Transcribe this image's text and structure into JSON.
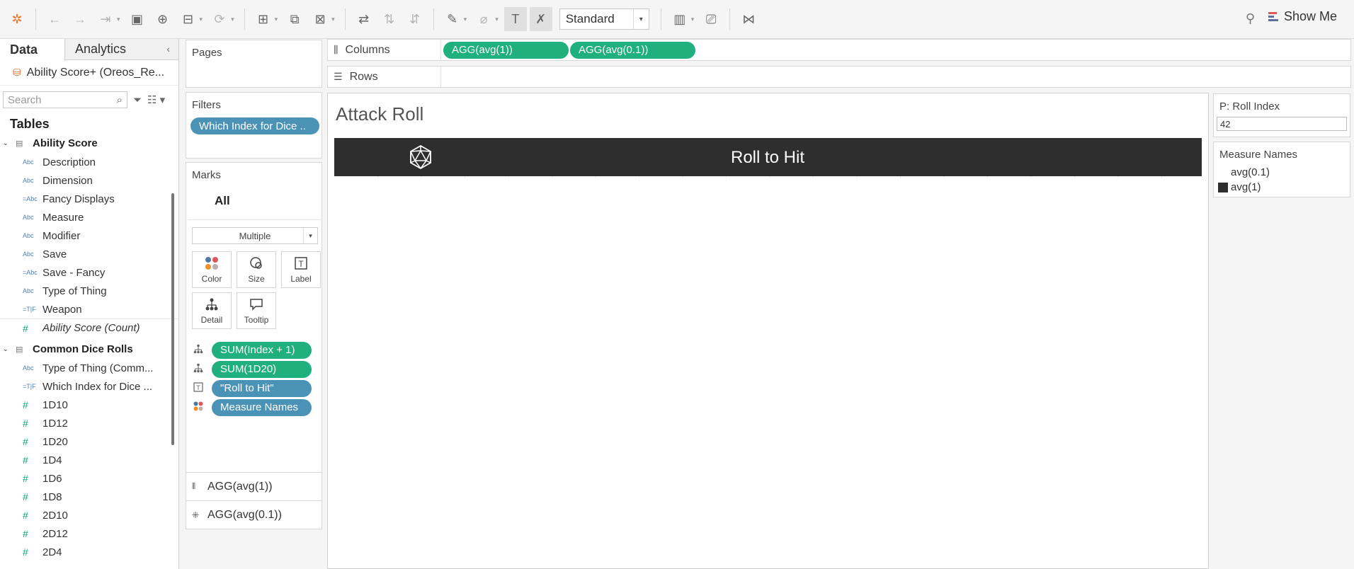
{
  "toolbar": {
    "fit_value": "Standard",
    "show_me_label": "Show Me"
  },
  "data_pane": {
    "tabs": [
      "Data",
      "Analytics"
    ],
    "datasource": "Ability Score+ (Oreos_Re...",
    "search_placeholder": "Search",
    "tables_title": "Tables",
    "tables": [
      {
        "name": "Ability Score",
        "fields": [
          {
            "type": "Abc",
            "name": "Description"
          },
          {
            "type": "Abc",
            "name": "Dimension"
          },
          {
            "type": "=Abc",
            "name": "Fancy Displays"
          },
          {
            "type": "Abc",
            "name": "Measure"
          },
          {
            "type": "Abc",
            "name": "Modifier"
          },
          {
            "type": "Abc",
            "name": "Save"
          },
          {
            "type": "=Abc",
            "name": "Save - Fancy"
          },
          {
            "type": "Abc",
            "name": "Type of Thing"
          },
          {
            "type": "=T|F",
            "name": "Weapon"
          },
          {
            "type": "#",
            "name": "Ability Score (Count)",
            "italic": true
          }
        ]
      },
      {
        "name": "Common Dice Rolls",
        "fields": [
          {
            "type": "Abc",
            "name": "Type of Thing (Comm..."
          },
          {
            "type": "=T|F",
            "name": "Which Index for Dice ..."
          },
          {
            "type": "#",
            "name": "1D10"
          },
          {
            "type": "#",
            "name": "1D12"
          },
          {
            "type": "#",
            "name": "1D20"
          },
          {
            "type": "#",
            "name": "1D4"
          },
          {
            "type": "#",
            "name": "1D6"
          },
          {
            "type": "#",
            "name": "1D8"
          },
          {
            "type": "#",
            "name": "2D10"
          },
          {
            "type": "#",
            "name": "2D12"
          },
          {
            "type": "#",
            "name": "2D4"
          }
        ]
      }
    ]
  },
  "pages": {
    "title": "Pages"
  },
  "filters": {
    "title": "Filters",
    "pill": "Which Index for Dice .."
  },
  "marks": {
    "title": "Marks",
    "all_label": "All",
    "mark_type": "Multiple",
    "buttons": [
      {
        "label": "Color",
        "icon": "color-icon"
      },
      {
        "label": "Size",
        "icon": "size-icon"
      },
      {
        "label": "Label",
        "icon": "label-icon"
      },
      {
        "label": "Detail",
        "icon": "detail-icon"
      },
      {
        "label": "Tooltip",
        "icon": "tooltip-icon"
      }
    ],
    "fields": [
      {
        "icon": "detail-icon",
        "label": "SUM(Index + 1)",
        "color": "green"
      },
      {
        "icon": "detail-icon",
        "label": "SUM(1D20)",
        "color": "green"
      },
      {
        "icon": "label-icon",
        "label": "\"Roll to Hit\"",
        "color": "blue"
      },
      {
        "icon": "color-icon",
        "label": "Measure Names",
        "color": "blue"
      }
    ],
    "agg_tabs": [
      {
        "label": "AGG(avg(1))",
        "icon": "bar-icon"
      },
      {
        "label": "AGG(avg(0.1))",
        "icon": "shape-icon"
      }
    ]
  },
  "shelves": {
    "columns_label": "Columns",
    "columns_pills": [
      "AGG(avg(1))",
      "AGG(avg(0.1))"
    ],
    "rows_label": "Rows"
  },
  "viz": {
    "title": "Attack Roll",
    "bar_label": "Roll to Hit",
    "bar_color": "#2e2e2e"
  },
  "legends": {
    "param_title": "P: Roll Index",
    "param_value": "42",
    "measure_title": "Measure Names",
    "items": [
      {
        "label": "avg(0.1)",
        "color": "#ffffff"
      },
      {
        "label": "avg(1)",
        "color": "#2e2e2e"
      }
    ]
  }
}
